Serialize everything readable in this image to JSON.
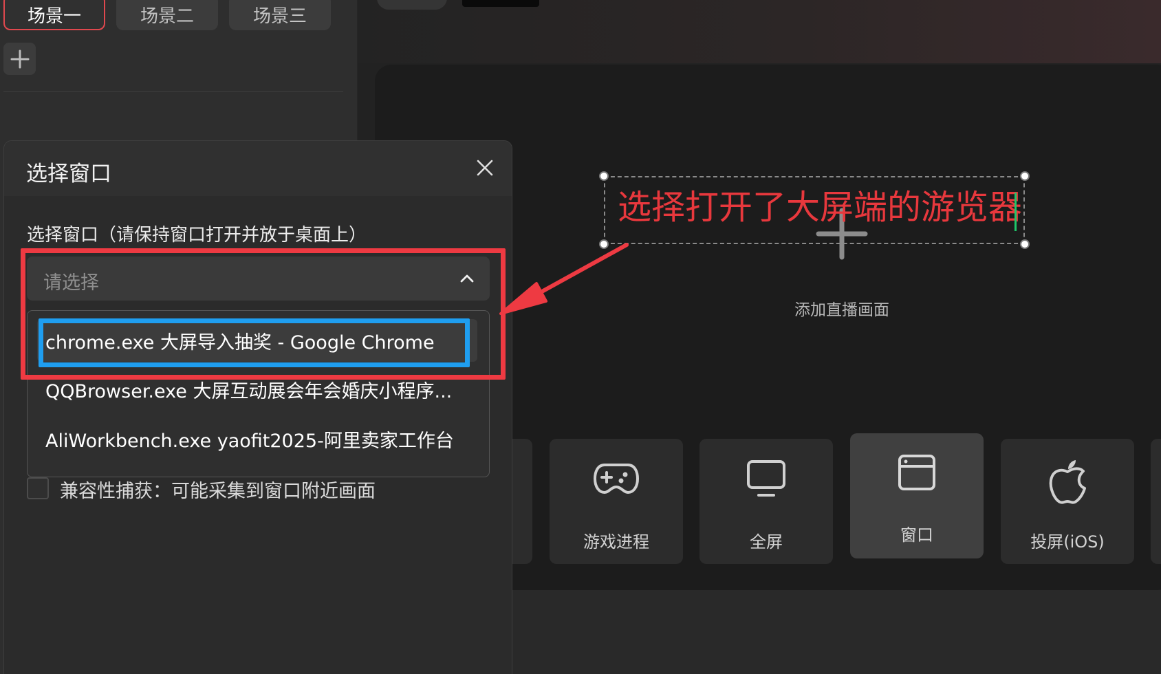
{
  "scene_tabs": [
    {
      "label": "场景一",
      "active": true
    },
    {
      "label": "场景二",
      "active": false
    },
    {
      "label": "场景三",
      "active": false
    }
  ],
  "preview": {
    "annotation_text": "选择打开了大屏端的游览器",
    "add_live_label": "添加直播画面"
  },
  "sources": [
    {
      "label": "游戏进程",
      "icon": "gamepad-icon"
    },
    {
      "label": "全屏",
      "icon": "monitor-icon"
    },
    {
      "label": "窗口",
      "icon": "window-icon",
      "active": true
    },
    {
      "label": "投屏(iOS)",
      "icon": "apple-icon"
    }
  ],
  "dialog": {
    "title": "选择窗口",
    "field_label": "选择窗口（请保持窗口打开并放于桌面上）",
    "select_placeholder": "请选择",
    "options": [
      "chrome.exe 大屏导入抽奖 - Google Chrome",
      "QQBrowser.exe 大屏互动展会年会婚庆小程序...",
      "AliWorkbench.exe yaofit2025-阿里卖家工作台"
    ],
    "compat_label": "兼容性捕获：可能采集到窗口附近画面",
    "compat_checked": false
  },
  "colors": {
    "accent_red": "#ee3a42",
    "highlight_blue": "#1f9ef0",
    "text_annotation_red": "#e8383d"
  }
}
